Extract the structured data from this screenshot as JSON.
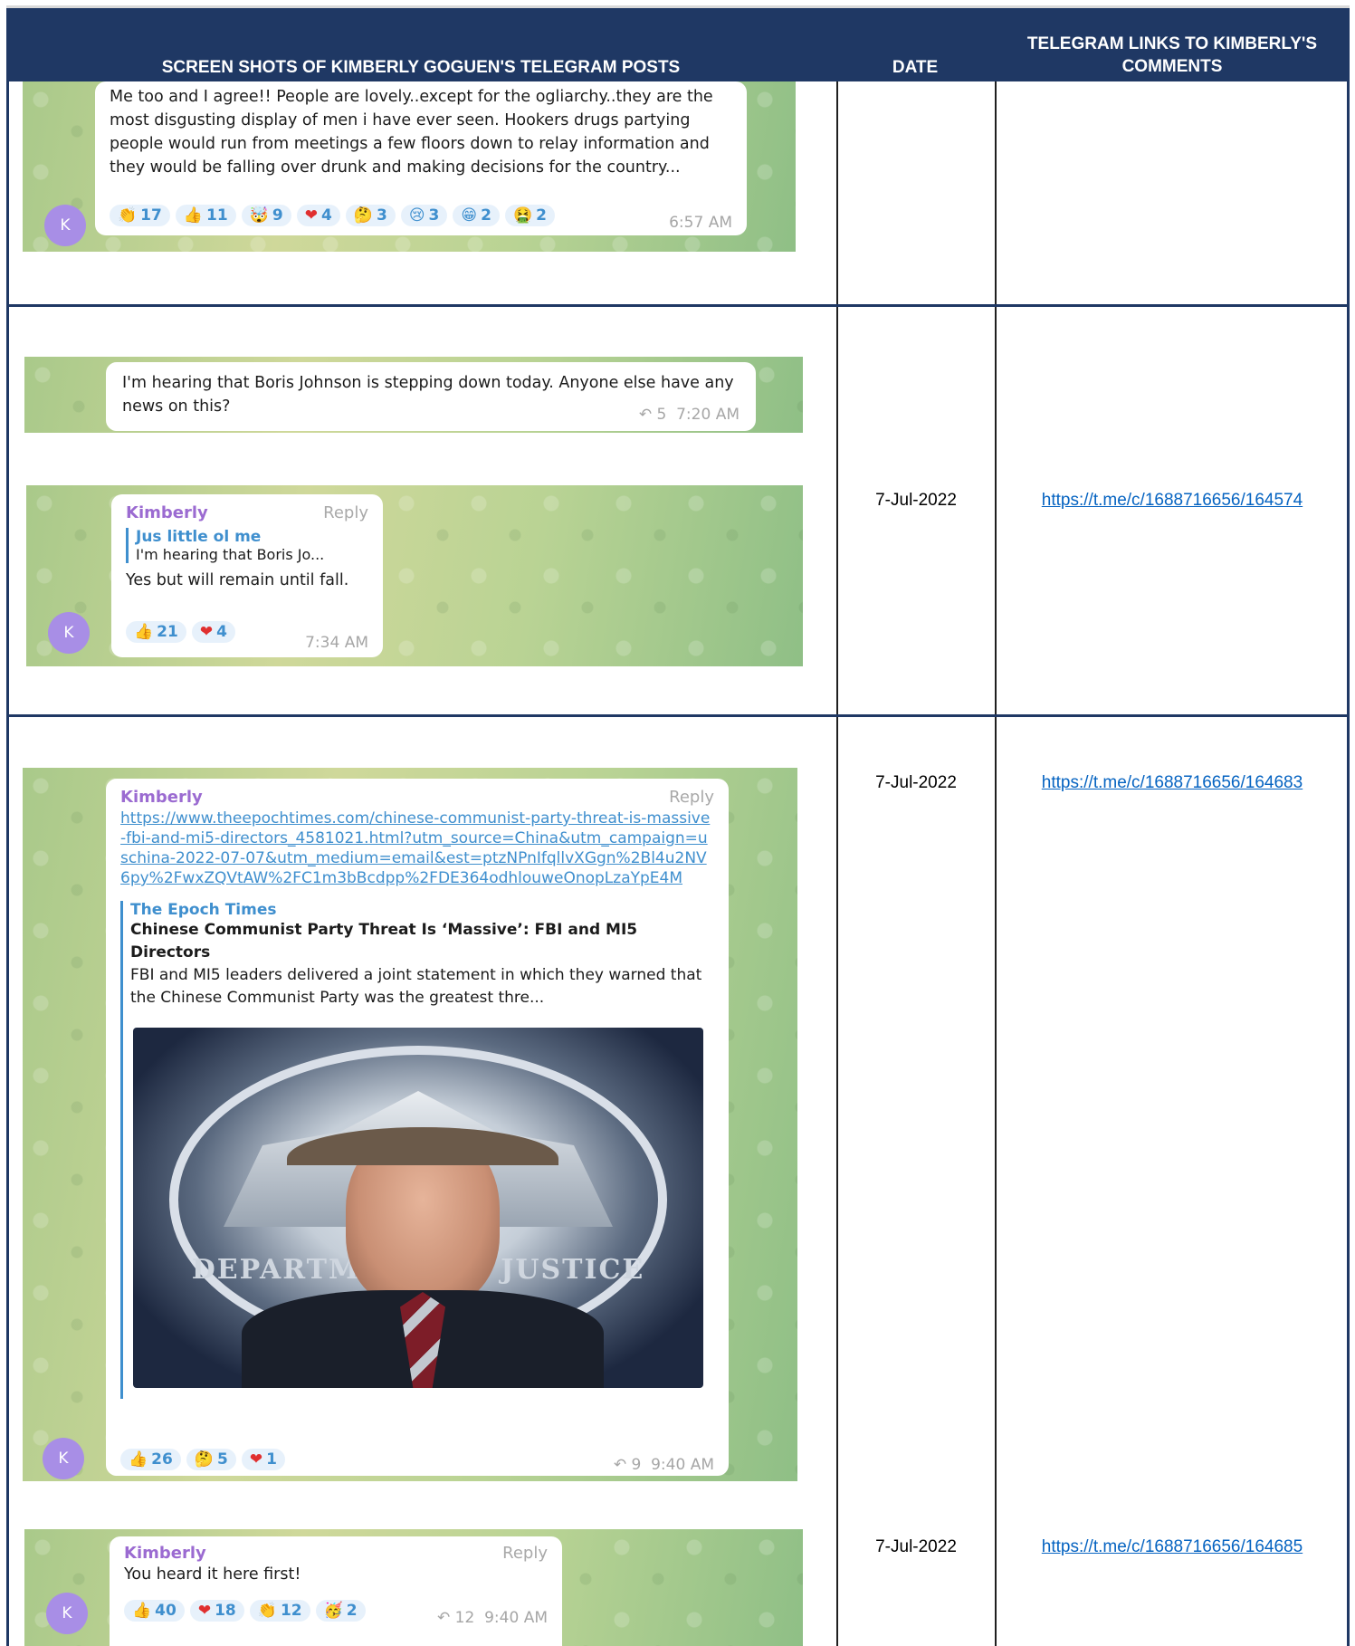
{
  "header": {
    "col1": "SCREEN SHOTS OF KIMBERLY GOGUEN'S TELEGRAM POSTS",
    "col2": "DATE",
    "col3": "TELEGRAM LINKS TO KIMBERLY'S COMMENTS"
  },
  "rows": [
    {
      "message": {
        "text": "Me too and I agree!! People are lovely..except for the ogliarchy..they are the most disgusting display of men i have ever seen. Hookers drugs partying people would run from meetings a few floors down to relay information and they would be falling over drunk and making decisions for the country...",
        "avatar": "K",
        "time": "6:57 AM",
        "reactions": [
          {
            "emoji": "👏",
            "count": "17"
          },
          {
            "emoji": "👍",
            "count": "11"
          },
          {
            "emoji": "🤯",
            "count": "9"
          },
          {
            "emoji": "❤",
            "count": "4"
          },
          {
            "emoji": "🤔",
            "count": "3"
          },
          {
            "emoji": "😢",
            "count": "3"
          },
          {
            "emoji": "😁",
            "count": "2"
          },
          {
            "emoji": "🤮",
            "count": "2"
          }
        ]
      }
    },
    {
      "date": "7-Jul-2022",
      "link": "https://t.me/c/1688716656/164574",
      "post": {
        "text": "I'm hearing that Boris Johnson is stepping down today. Anyone else have any news on this?",
        "forwards": "5",
        "time": "7:20 AM"
      },
      "reply": {
        "sender": "Kimberly",
        "reply_label": "Reply",
        "quote_name": "Jus little ol me",
        "quote_text": "I'm hearing that Boris Jo...",
        "text": "Yes but will remain until fall.",
        "avatar": "K",
        "time": "7:34 AM",
        "reactions": [
          {
            "emoji": "👍",
            "count": "21"
          },
          {
            "emoji": "❤",
            "count": "4"
          }
        ]
      }
    },
    {
      "date": "7-Jul-2022",
      "link": "https://t.me/c/1688716656/164683",
      "message": {
        "sender": "Kimberly",
        "reply_label": "Reply",
        "url": "https://www.theepochtimes.com/chinese-communist-party-threat-is-massive-fbi-and-mi5-directors_4581021.html?utm_source=China&utm_campaign=uschina-2022-07-07&utm_medium=email&est=ptzNPnIfqllvXGgn%2Bl4u2NV6py%2FwxZQVtAW%2FC1m3bBcdpp%2FDE364odhlouweOnopLzaYpE4M",
        "preview_site": "The Epoch Times",
        "preview_title": "Chinese Communist Party Threat Is ‘Massive’: FBI and MI5 Directors",
        "preview_desc": "FBI and MI5 leaders delivered a joint statement in which they warned that the Chinese Communist Party was the greatest thre...",
        "photo_text": "DEPARTMENT OF JUSTICE",
        "avatar": "K",
        "forwards": "9",
        "time": "9:40 AM",
        "reactions": [
          {
            "emoji": "👍",
            "count": "26"
          },
          {
            "emoji": "🤔",
            "count": "5"
          },
          {
            "emoji": "❤",
            "count": "1"
          }
        ]
      }
    },
    {
      "date": "7-Jul-2022",
      "link": "https://t.me/c/1688716656/164685",
      "message": {
        "sender": "Kimberly",
        "reply_label": "Reply",
        "text": "You heard it here first!",
        "avatar": "K",
        "forwards": "12",
        "time": "9:40 AM",
        "reactions": [
          {
            "emoji": "👍",
            "count": "40"
          },
          {
            "emoji": "❤",
            "count": "18"
          },
          {
            "emoji": "👏",
            "count": "12"
          },
          {
            "emoji": "🥳",
            "count": "2"
          }
        ]
      }
    }
  ]
}
